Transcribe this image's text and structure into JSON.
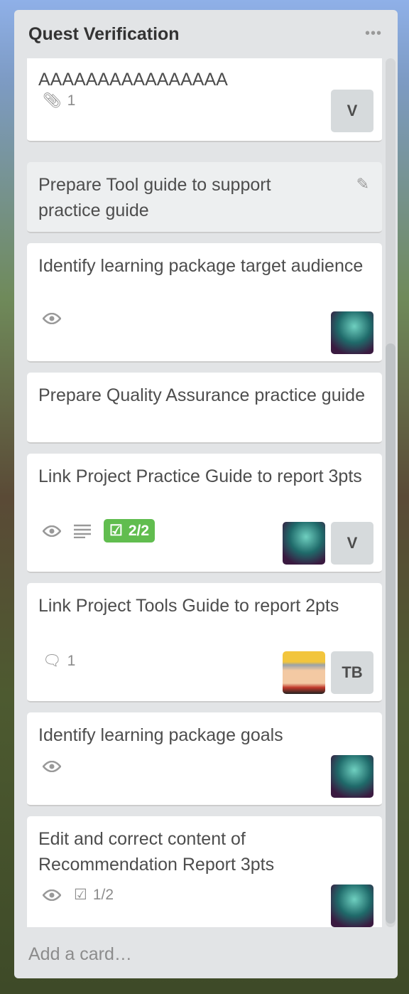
{
  "list": {
    "title": "Quest Verification",
    "menu_icon": "ellipsis-icon",
    "add_card": "Add a card…"
  },
  "cards": [
    {
      "title": "AAAAAAAAAAAAAAAA",
      "attachments": "1",
      "members": [
        "V"
      ]
    },
    {
      "title": "Prepare Tool guide to support practice guide",
      "edit_icon": "pencil-icon"
    },
    {
      "title": "Identify learning package target audience",
      "watching": true,
      "members": [
        "avatar"
      ]
    },
    {
      "title": "Prepare Quality Assurance practice guide"
    },
    {
      "title": "Link Project Practice Guide to report 3pts",
      "watching": true,
      "description": true,
      "checklist": "2/2",
      "checklist_color": "#61bd4f",
      "members": [
        "avatar",
        "V"
      ]
    },
    {
      "title": "Link Project Tools Guide to report 2pts",
      "comments": "1",
      "members": [
        "avatar",
        "TB"
      ]
    },
    {
      "title": "Identify learning package goals",
      "watching": true,
      "members": [
        "avatar"
      ]
    },
    {
      "title": "Edit and correct content of Recommendation Report 3pts",
      "watching": true,
      "checklist": "1/2",
      "members": [
        "avatar"
      ]
    }
  ]
}
